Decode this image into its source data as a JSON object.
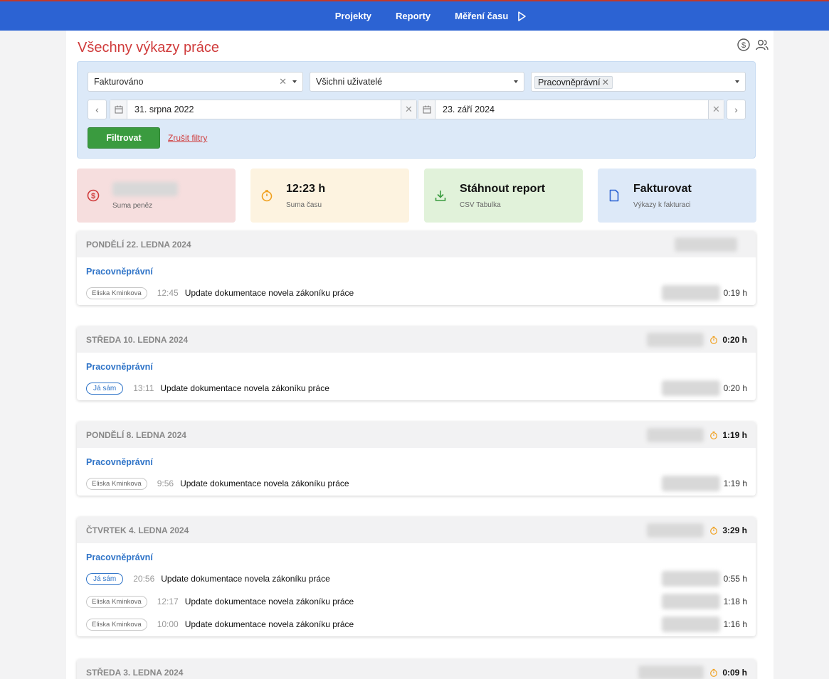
{
  "nav": {
    "items": [
      "Projekty",
      "Reporty",
      "Měření času"
    ]
  },
  "page": {
    "title": "Všechny výkazy práce"
  },
  "filters": {
    "status": "Fakturováno",
    "users": "Všichni uživatelé",
    "tag": "Pracovněprávní",
    "date_from": "31. srpna 2022",
    "date_to": "23. září 2024",
    "submit": "Filtrovat",
    "reset": "Zrušit filtry"
  },
  "cards": {
    "money_label": "Suma peněz",
    "time_value": "12:23 h",
    "time_label": "Suma času",
    "download_title": "Stáhnout report",
    "download_sub": "CSV Tabulka",
    "invoice_title": "Fakturovat",
    "invoice_sub": "Výkazy k fakturaci"
  },
  "colors": {
    "nav": "#2c63d3",
    "title": "#d03c3c",
    "filter": "#3a9b3f",
    "project": "#2f74c8",
    "timer": "#f0a01e"
  },
  "days": [
    {
      "title": "PONDĚLÍ 22. LEDNA 2024",
      "total": "",
      "project": "Pracovněprávní",
      "rows": [
        {
          "user": "Eliska Kminkova",
          "me": false,
          "time": "12:45",
          "desc": "Update dokumentace novela zákoníku práce",
          "dur": "0:19 h"
        }
      ]
    },
    {
      "title": "STŘEDA 10. LEDNA 2024",
      "total": "0:20 h",
      "project": "Pracovněprávní",
      "rows": [
        {
          "user": "Já sám",
          "me": true,
          "time": "13:11",
          "desc": "Update dokumentace novela zákoníku práce",
          "dur": "0:20 h"
        }
      ]
    },
    {
      "title": "PONDĚLÍ 8. LEDNA 2024",
      "total": "1:19 h",
      "project": "Pracovněprávní",
      "rows": [
        {
          "user": "Eliska Kminkova",
          "me": false,
          "time": "9:56",
          "desc": "Update dokumentace novela zákoníku práce",
          "dur": "1:19 h"
        }
      ]
    },
    {
      "title": "ČTVRTEK 4. LEDNA 2024",
      "total": "3:29 h",
      "project": "Pracovněprávní",
      "rows": [
        {
          "user": "Já sám",
          "me": true,
          "time": "20:56",
          "desc": "Update dokumentace novela zákoníku práce",
          "dur": "0:55 h"
        },
        {
          "user": "Eliska Kminkova",
          "me": false,
          "time": "12:17",
          "desc": "Update dokumentace novela zákoníku práce",
          "dur": "1:18 h"
        },
        {
          "user": "Eliska Kminkova",
          "me": false,
          "time": "10:00",
          "desc": "Update dokumentace novela zákoníku práce",
          "dur": "1:16 h"
        }
      ]
    },
    {
      "title": "STŘEDA 3. LEDNA 2024",
      "total": "0:09 h",
      "project": "",
      "rows": []
    }
  ]
}
